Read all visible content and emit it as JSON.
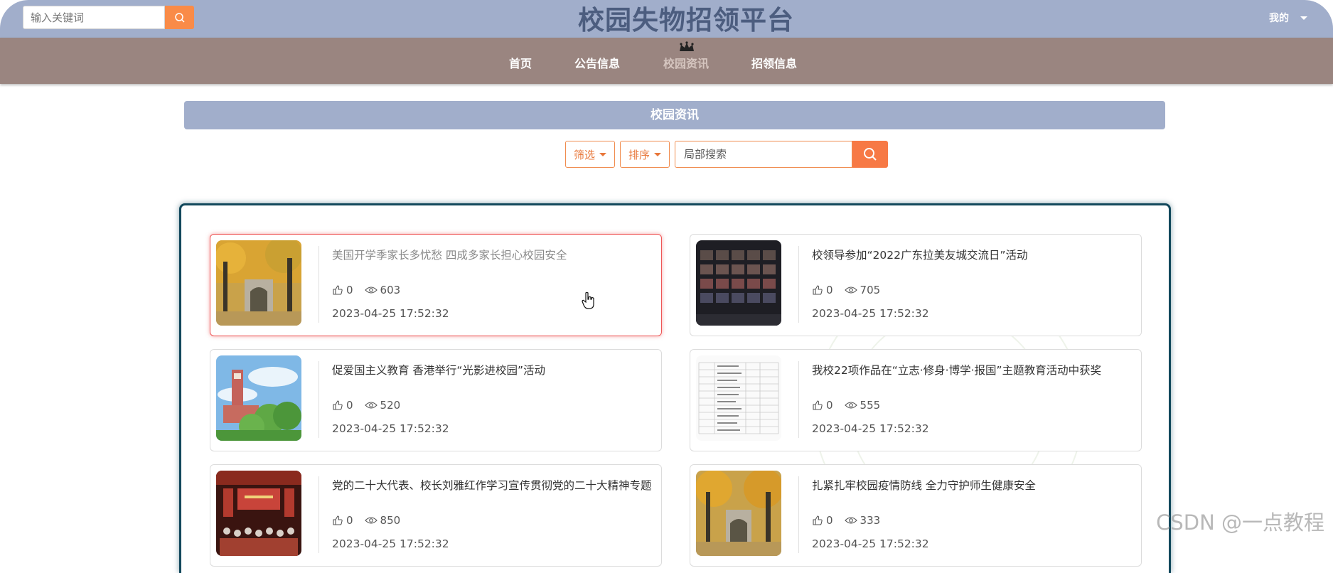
{
  "header": {
    "search_placeholder": "输入关键词",
    "site_title": "校园失物招领平台",
    "user_menu": "我的"
  },
  "nav": {
    "items": [
      {
        "label": "首页"
      },
      {
        "label": "公告信息"
      },
      {
        "label": "校园资讯"
      },
      {
        "label": "招领信息"
      }
    ],
    "active": "校园资讯"
  },
  "section": {
    "title": "校园资讯",
    "filter_label": "筛选",
    "sort_label": "排序",
    "local_search_placeholder": "局部搜索"
  },
  "news": [
    {
      "title": "美国开学季家长多忧愁 四成多家长担心校园安全",
      "likes": "0",
      "views": "603",
      "date": "2023-04-25 17:52:32"
    },
    {
      "title": "校领导参加“2022广东拉美友城交流日”活动",
      "likes": "0",
      "views": "705",
      "date": "2023-04-25 17:52:32"
    },
    {
      "title": "促爱国主义教育 香港举行“光影进校园”活动",
      "likes": "0",
      "views": "520",
      "date": "2023-04-25 17:52:32"
    },
    {
      "title": "我校22项作品在“立志·修身·博学·报国”主题教育活动中获奖",
      "likes": "0",
      "views": "555",
      "date": "2023-04-25 17:52:32"
    },
    {
      "title": "党的二十大代表、校长刘雅红作学习宣传贯彻党的二十大精神专题",
      "likes": "0",
      "views": "850",
      "date": "2023-04-25 17:52:32"
    },
    {
      "title": "扎紧扎牢校园疫情防线 全力守护师生健康安全",
      "likes": "0",
      "views": "333",
      "date": "2023-04-25 17:52:32"
    }
  ],
  "watermark": "CSDN @一点教程",
  "colors": {
    "header_bg": "#a1aecb",
    "nav_bg": "#9a8580",
    "accent": "#f98b48",
    "panel_border": "#12485c"
  }
}
